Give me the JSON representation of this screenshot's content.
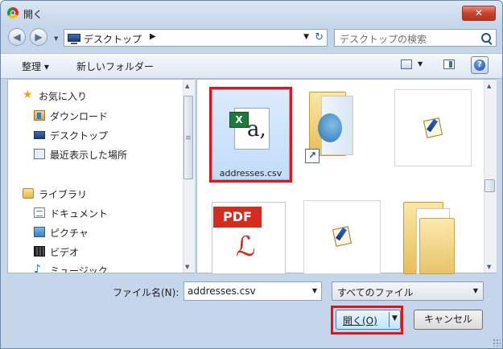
{
  "window": {
    "title": "開く",
    "close_label": "✕"
  },
  "address": {
    "location": "デスクトップ",
    "search_placeholder": "デスクトップの検索"
  },
  "toolbar": {
    "organize": "整理 ▾",
    "new_folder": "新しいフォルダー",
    "help": "?"
  },
  "nav": {
    "favorites": "お気に入り",
    "favorites_items": [
      "ダウンロード",
      "デスクトップ",
      "最近表示した場所"
    ],
    "libraries": "ライブラリ",
    "libraries_items": [
      "ドキュメント",
      "ピクチャ",
      "ビデオ",
      "ミュージック"
    ]
  },
  "files": {
    "selected_name": "addresses.csv",
    "csv_badge": "X",
    "csv_glyph": "a,",
    "pdf_badge": "PDF",
    "pdf_glyph": "ℒ"
  },
  "bottom": {
    "filename_label": "ファイル名(N):",
    "filename_value": "addresses.csv",
    "filter_value": "すべてのファイル",
    "open_label": "開く(O)",
    "cancel_label": "キャンセル"
  },
  "colors": {
    "highlight": "#e0141c",
    "selection": "#cce4fb",
    "accent": "#3c7fb1"
  },
  "icons": [
    "chrome-icon",
    "back-icon",
    "forward-icon",
    "monitor-icon",
    "refresh-icon",
    "search-icon",
    "view-icon",
    "preview-pane-icon",
    "help-icon",
    "star-icon",
    "download-folder-icon",
    "recent-places-icon",
    "library-icon",
    "document-icon",
    "pictures-icon",
    "video-icon",
    "music-icon",
    "excel-csv-icon",
    "folder-icon",
    "shortcut-arrow-icon",
    "pdf-icon"
  ]
}
